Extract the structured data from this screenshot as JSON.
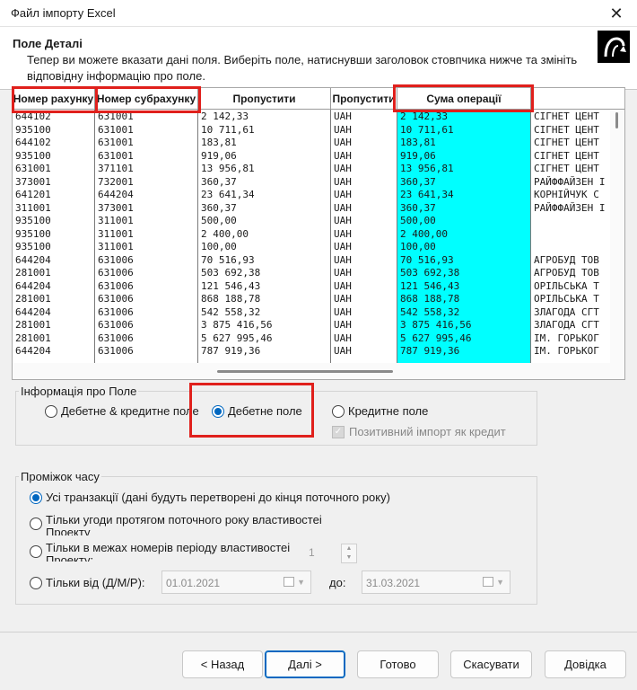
{
  "window": {
    "title": "Файл імпорту Excel",
    "close_glyph": "✕"
  },
  "header": {
    "title": "Поле Деталі",
    "description": "Тепер ви можете вказати дані поля. Виберіть поле, натиснувши заголовок стовпчика нижче та змініть відповідну інформацію про поле.",
    "logo_icon": "arrow-turn-icon"
  },
  "grid": {
    "columns": [
      "Номер рахунку",
      "Номер субрахунку",
      "Пропустити",
      "Пропустити",
      "Сума операції",
      ""
    ],
    "highlighted_color": "#00ffff",
    "rows": [
      [
        "644102",
        "631001",
        "2 142,33",
        "UAH",
        "2 142,33",
        "СІГНЕТ ЦЕНТ"
      ],
      [
        "935100",
        "631001",
        "10 711,61",
        "UAH",
        "10 711,61",
        "СІГНЕТ ЦЕНТ"
      ],
      [
        "644102",
        "631001",
        "183,81",
        "UAH",
        "183,81",
        "СІГНЕТ ЦЕНТ"
      ],
      [
        "935100",
        "631001",
        "919,06",
        "UAH",
        "919,06",
        "СІГНЕТ ЦЕНТ"
      ],
      [
        "631001",
        "371101",
        "13 956,81",
        "UAH",
        "13 956,81",
        "СІГНЕТ ЦЕНТ"
      ],
      [
        "373001",
        "732001",
        "360,37",
        "UAH",
        "360,37",
        "РАЙФФАЙЗЕН І"
      ],
      [
        "641201",
        "644204",
        "23 641,34",
        "UAH",
        "23 641,34",
        "КОРНІЙЧУК С"
      ],
      [
        "311001",
        "373001",
        "360,37",
        "UAH",
        "360,37",
        "РАЙФФАЙЗЕН І"
      ],
      [
        "935100",
        "311001",
        "500,00",
        "UAH",
        "500,00",
        ""
      ],
      [
        "935100",
        "311001",
        "2 400,00",
        "UAH",
        "2 400,00",
        ""
      ],
      [
        "935100",
        "311001",
        "100,00",
        "UAH",
        "100,00",
        ""
      ],
      [
        "644204",
        "631006",
        "70 516,93",
        "UAH",
        "70 516,93",
        "АГРОБУД ТОВ"
      ],
      [
        "281001",
        "631006",
        "503 692,38",
        "UAH",
        "503 692,38",
        "АГРОБУД ТОВ"
      ],
      [
        "644204",
        "631006",
        "121 546,43",
        "UAH",
        "121 546,43",
        "ОРІЛЬСЬКА Т"
      ],
      [
        "281001",
        "631006",
        "868 188,78",
        "UAH",
        "868 188,78",
        "ОРІЛЬСЬКА Т"
      ],
      [
        "644204",
        "631006",
        "542 558,32",
        "UAH",
        "542 558,32",
        "ЗЛАГОДА СГТ"
      ],
      [
        "281001",
        "631006",
        "3 875 416,56",
        "UAH",
        "3 875 416,56",
        "ЗЛАГОДА СГТ"
      ],
      [
        "281001",
        "631006",
        "5 627 995,46",
        "UAH",
        "5 627 995,46",
        "ІМ. ГОРЬКОГ"
      ],
      [
        "644204",
        "631006",
        "787 919,36",
        "UAH",
        "787 919,36",
        "ІМ. ГОРЬКОГ"
      ]
    ]
  },
  "field_info": {
    "label": "Інформація про Поле",
    "options": [
      "Дебетне & кредитне поле",
      "Дебетне поле",
      "Кредитне поле"
    ],
    "selected": 1,
    "positive_credit_label": "Позитивний імпорт як кредит"
  },
  "period": {
    "label": "Проміжок часу",
    "opt_all": "Усі транзакції (дані будуть перетворені до кінця поточного року)",
    "opt_current_year_1": "Тільки угоди протягом поточного року властивостеі",
    "opt_current_year_2": "Проекту",
    "opt_period_numbers_1": "Тільки в межах номерів періоду властивостеі",
    "opt_period_numbers_2": "Проекту:",
    "period_number": "1",
    "opt_from": "Тільки від (Д/М/Р):",
    "date_from": "01.01.2021",
    "to_label": "до:",
    "date_to": "31.03.2021"
  },
  "buttons": {
    "back": "< Назад",
    "next": "Далі >",
    "done": "Готово",
    "cancel": "Скасувати",
    "help": "Довідка"
  },
  "accent_color": "#0067c0",
  "annotation_color": "#e0201c"
}
